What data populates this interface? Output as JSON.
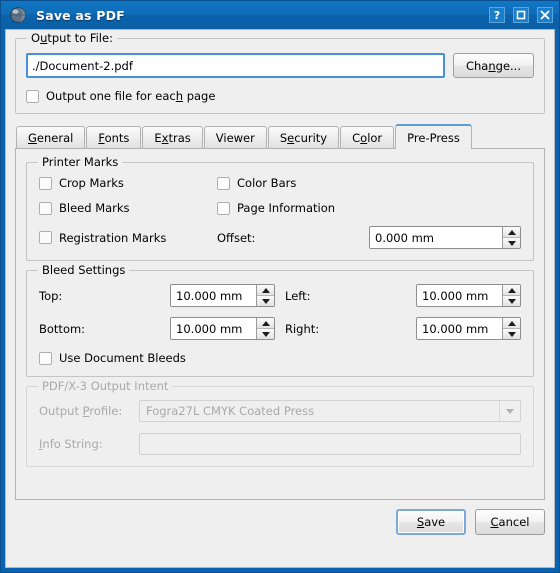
{
  "window": {
    "title": "Save as PDF",
    "icon": "globe-icon",
    "controls": {
      "help": "?",
      "maximize": "□",
      "close": "✕"
    },
    "accent_color": "#0c63ac",
    "frame_color": "#0a63b0"
  },
  "output_group": {
    "title": "Output to File:",
    "title_mnemonic": "u",
    "file_field": {
      "value": "./Document-2.pdf",
      "placeholder": ""
    },
    "change_button": {
      "label": "Change...",
      "mnemonic": "n"
    },
    "each_page_checkbox": {
      "label": "Output one file for each page",
      "mnemonic": "h",
      "checked": false
    }
  },
  "tabs": [
    {
      "label": "General",
      "mnemonic": "G",
      "active": false
    },
    {
      "label": "Fonts",
      "mnemonic": "F",
      "active": false
    },
    {
      "label": "Extras",
      "mnemonic": "x",
      "active": false
    },
    {
      "label": "Viewer",
      "mnemonic": "",
      "active": false
    },
    {
      "label": "Security",
      "mnemonic": "e",
      "active": false
    },
    {
      "label": "Color",
      "mnemonic": "l",
      "active": false
    },
    {
      "label": "Pre-Press",
      "mnemonic": "",
      "active": true
    }
  ],
  "printer_marks": {
    "title": "Printer Marks",
    "checkboxes": [
      {
        "label": "Crop Marks",
        "checked": false
      },
      {
        "label": "Color Bars",
        "checked": false
      },
      {
        "label": "Bleed Marks",
        "checked": false
      },
      {
        "label": "Page Information",
        "checked": false
      },
      {
        "label": "Registration Marks",
        "checked": false
      }
    ],
    "offset_label": "Offset:",
    "offset_value": "0.000 mm"
  },
  "bleed_settings": {
    "title": "Bleed Settings",
    "fields": [
      {
        "label": "Top:",
        "value": "10.000 mm"
      },
      {
        "label": "Left:",
        "value": "10.000 mm"
      },
      {
        "label": "Bottom:",
        "value": "10.000 mm"
      },
      {
        "label": "Right:",
        "value": "10.000 mm"
      }
    ],
    "use_document_bleeds": {
      "label": "Use Document Bleeds",
      "checked": false
    }
  },
  "output_intent": {
    "title": "PDF/X-3 Output Intent",
    "enabled": false,
    "profile_label": "Output Profile:",
    "profile_mnemonic": "P",
    "profile_value": "Fogra27L CMYK Coated Press",
    "info_label": "Info String:",
    "info_mnemonic": "I",
    "info_value": ""
  },
  "footer": {
    "save_label": "Save",
    "save_mnemonic": "S",
    "cancel_label": "Cancel",
    "cancel_mnemonic": "C"
  }
}
